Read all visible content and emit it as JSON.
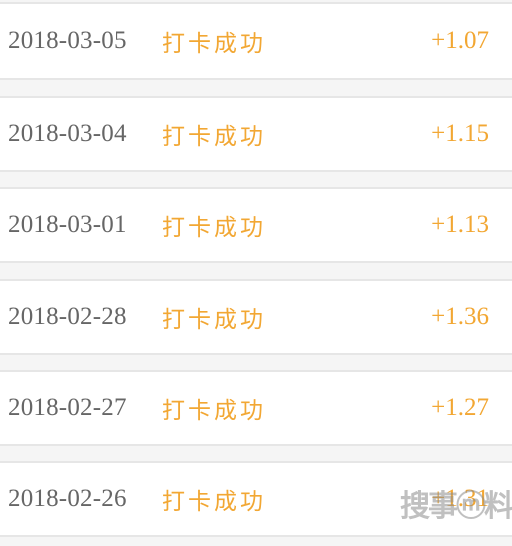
{
  "records": [
    {
      "date": "2018-03-05",
      "status": "打卡成功",
      "points": "+1.07"
    },
    {
      "date": "2018-03-04",
      "status": "打卡成功",
      "points": "+1.15"
    },
    {
      "date": "2018-03-01",
      "status": "打卡成功",
      "points": "+1.13"
    },
    {
      "date": "2018-02-28",
      "status": "打卡成功",
      "points": "+1.36"
    },
    {
      "date": "2018-02-27",
      "status": "打卡成功",
      "points": "+1.27"
    },
    {
      "date": "2018-02-26",
      "status": "打卡成功",
      "points": "+1.31"
    }
  ],
  "watermark": {
    "text": "搜事ⓜ料"
  },
  "colors": {
    "status": "#f2a733",
    "date": "#666666",
    "separator": "#f5f5f5",
    "border": "#e6e6e6"
  }
}
